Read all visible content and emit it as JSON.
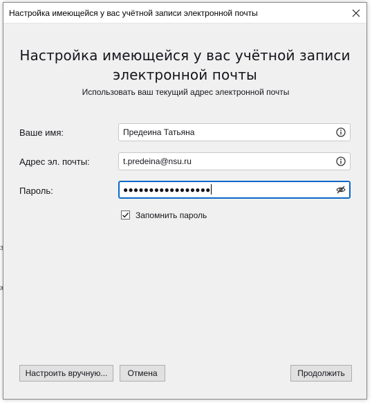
{
  "window": {
    "title": "Настройка имеющейся у вас учётной записи электронной почты"
  },
  "header": {
    "heading_line1": "Настройка имеющейся у вас учётной записи",
    "heading_line2": "электронной почты",
    "subheading": "Использовать ваш текущий адрес электронной почты"
  },
  "form": {
    "name_label": "Ваше имя:",
    "name_value": "Предеина Татьяна",
    "email_label": "Адрес эл. почты:",
    "email_value": "t.predeina@nsu.ru",
    "password_label": "Пароль:",
    "password_mask": "●●●●●●●●●●●●●●●●●",
    "remember_label": "Запомнить пароль",
    "remember_checked": true
  },
  "buttons": {
    "manual_config": "Настроить вручную...",
    "cancel": "Отмена",
    "continue": "Продолжить"
  },
  "icons": {
    "name_info": "info-icon",
    "email_info": "info-icon",
    "password_toggle": "eye-slash-icon",
    "close": "close-icon",
    "check": "checkmark-icon"
  },
  "colors": {
    "dialog_bg": "#f0f0f0",
    "focus_border": "#0a67c8",
    "button_bg": "#e1e1e1"
  }
}
